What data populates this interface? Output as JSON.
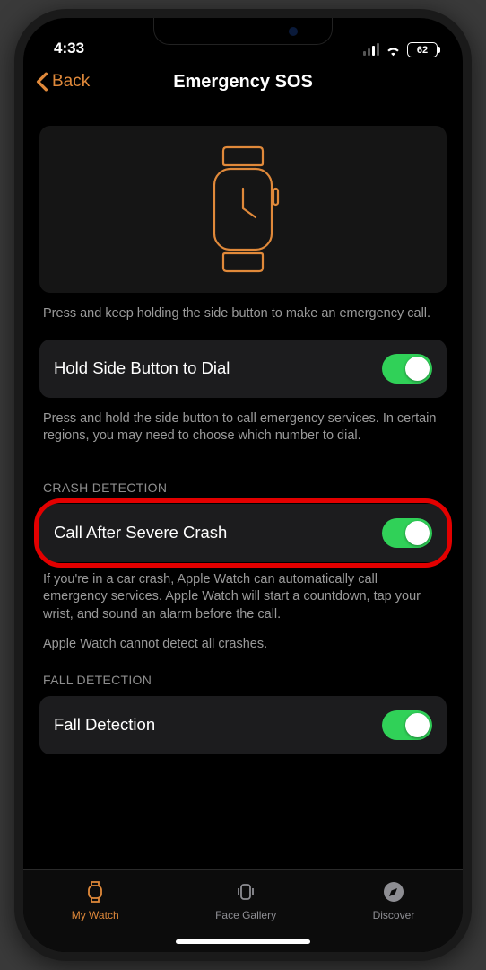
{
  "statusbar": {
    "time": "4:33",
    "battery": "62"
  },
  "nav": {
    "back": "Back",
    "title": "Emergency SOS"
  },
  "hero_hint": "Press and keep holding the side button to make an emergency call.",
  "hold_row": {
    "label": "Hold Side Button to Dial",
    "hint": "Press and hold the side button to call emergency services. In certain regions, you may need to choose which number to dial."
  },
  "crash": {
    "header": "CRASH DETECTION",
    "label": "Call After Severe Crash",
    "hint": "If you're in a car crash, Apple Watch can automatically call emergency services. Apple Watch will start a countdown, tap your wrist, and sound an alarm before the call.",
    "note": "Apple Watch cannot detect all crashes."
  },
  "fall": {
    "header": "FALL DETECTION",
    "label": "Fall Detection"
  },
  "tabs": {
    "watch": "My Watch",
    "gallery": "Face Gallery",
    "discover": "Discover"
  }
}
